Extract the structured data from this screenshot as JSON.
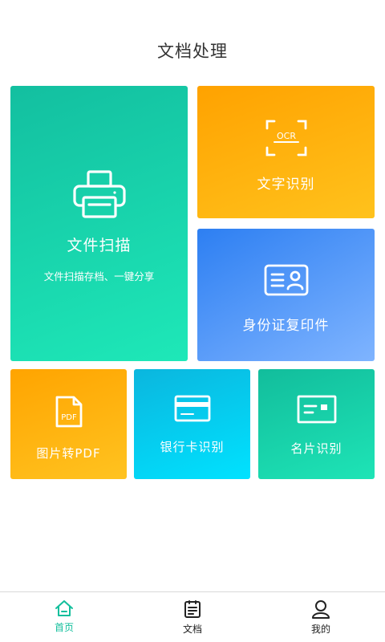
{
  "header": {
    "title": "文档处理"
  },
  "tiles": {
    "scan": {
      "label": "文件扫描",
      "sub": "文件扫描存档、一键分享",
      "icon": "printer-icon"
    },
    "ocr": {
      "label": "文字识别",
      "icon_text": "OCR",
      "icon": "ocr-scan-icon"
    },
    "id_copy": {
      "label": "身份证复印件",
      "icon": "id-card-icon"
    },
    "pdf": {
      "label": "图片转PDF",
      "icon_text": "PDF",
      "icon": "pdf-file-icon"
    },
    "bank": {
      "label": "银行卡识别",
      "icon": "bank-card-icon"
    },
    "business_card": {
      "label": "名片识别",
      "icon": "business-card-icon"
    }
  },
  "tabbar": {
    "items": [
      {
        "label": "首页",
        "icon": "home-icon",
        "active": true
      },
      {
        "label": "文档",
        "icon": "document-list-icon",
        "active": false
      },
      {
        "label": "我的",
        "icon": "user-icon",
        "active": false
      }
    ]
  },
  "colors": {
    "accent": "#13bf9c",
    "scan_tile": "#13bfa0",
    "ocr_tile": "#ffa200",
    "id_tile": "#2d7ff2",
    "pdf_tile": "#ffa400",
    "bank_tile": "#0bb6de",
    "business_card_tile": "#12bd9c"
  }
}
